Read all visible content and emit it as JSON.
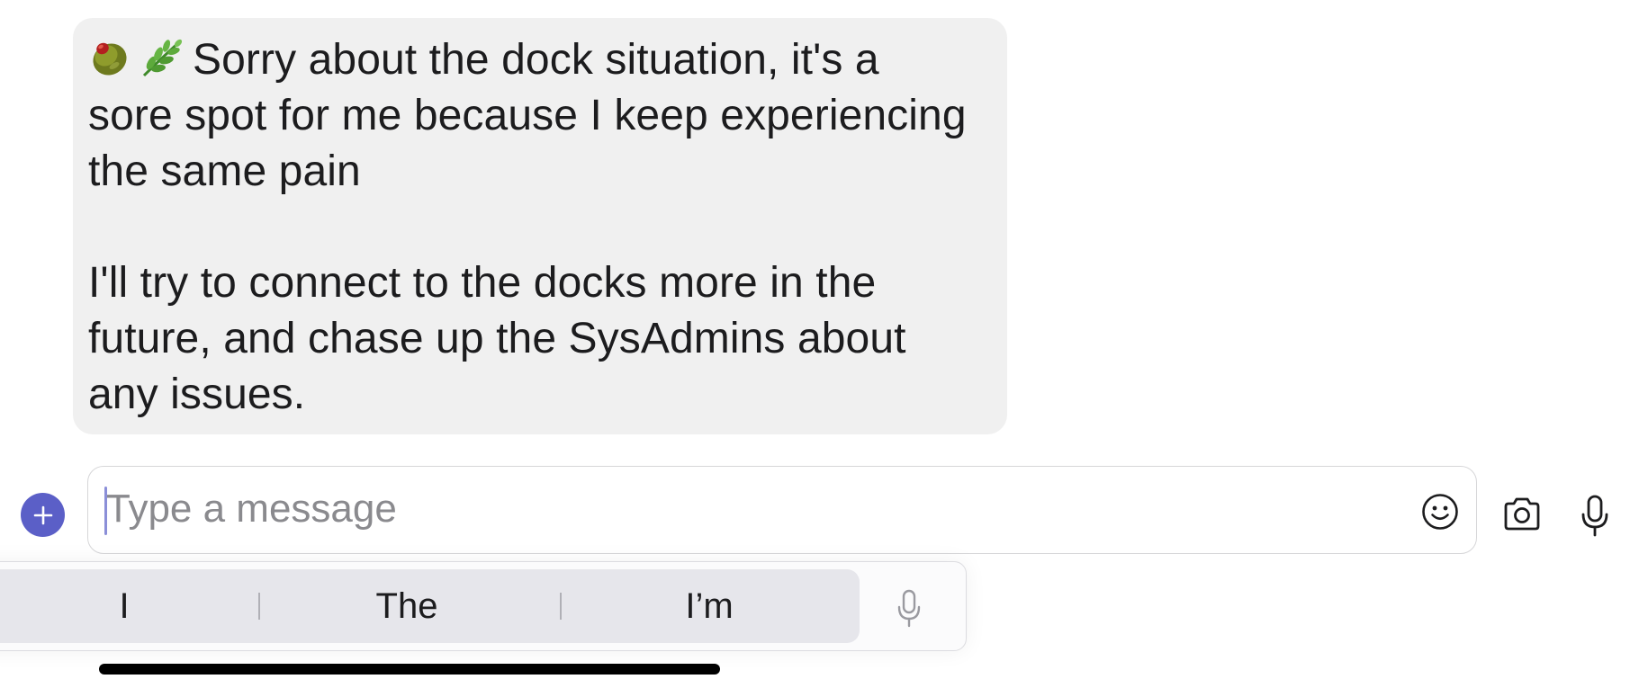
{
  "message": {
    "emojis": [
      "olive-emoji",
      "herb-emoji"
    ],
    "lines": [
      "Sorry about the dock situation, it's a",
      "sore spot for me because I keep experiencing",
      "the same pain",
      "I'll try to connect to the docks more in the",
      "future, and chase up the SysAdmins about",
      "any issues."
    ]
  },
  "composer": {
    "placeholder": "Type a message",
    "value": "",
    "icons": [
      "plus-icon",
      "emoji-icon",
      "camera-icon",
      "microphone-icon"
    ]
  },
  "keyboard": {
    "suggestions": [
      "I",
      "The",
      "I’m"
    ],
    "icons": [
      "dictation-mic-icon"
    ]
  },
  "colors": {
    "accent": "#5b5fc7",
    "bubble_background": "#f0f0f0",
    "caret": "#8b8fd8",
    "placeholder": "#8a8a8e"
  }
}
